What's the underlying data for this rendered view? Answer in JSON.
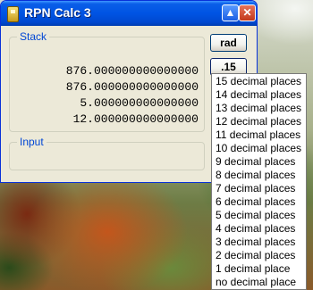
{
  "window": {
    "title": "RPN Calc 3",
    "titlebar_buttons": {
      "roll_up": "▲",
      "close": "✕"
    }
  },
  "stack": {
    "label": "Stack",
    "lines": [
      "876.000000000000000",
      "876.000000000000000",
      "5.000000000000000",
      "12.000000000000000"
    ]
  },
  "input": {
    "label": "Input",
    "value": ""
  },
  "buttons": {
    "angle_mode": "rad",
    "decimals": ".15"
  },
  "decimal_menu": {
    "items": [
      "15 decimal places",
      "14 decimal places",
      "13 decimal places",
      "12 decimal places",
      "11 decimal places",
      "10 decimal places",
      "9 decimal places",
      "8 decimal places",
      "7 decimal places",
      "6 decimal places",
      "5 decimal places",
      "4 decimal places",
      "3 decimal places",
      "2 decimal places",
      "1 decimal place",
      "no decimal place"
    ]
  },
  "icons": {
    "app": "calculator-icon"
  },
  "colors": {
    "titlebar": "#0054e3",
    "group_label": "#0046d5",
    "window_bg": "#ece9d8"
  }
}
